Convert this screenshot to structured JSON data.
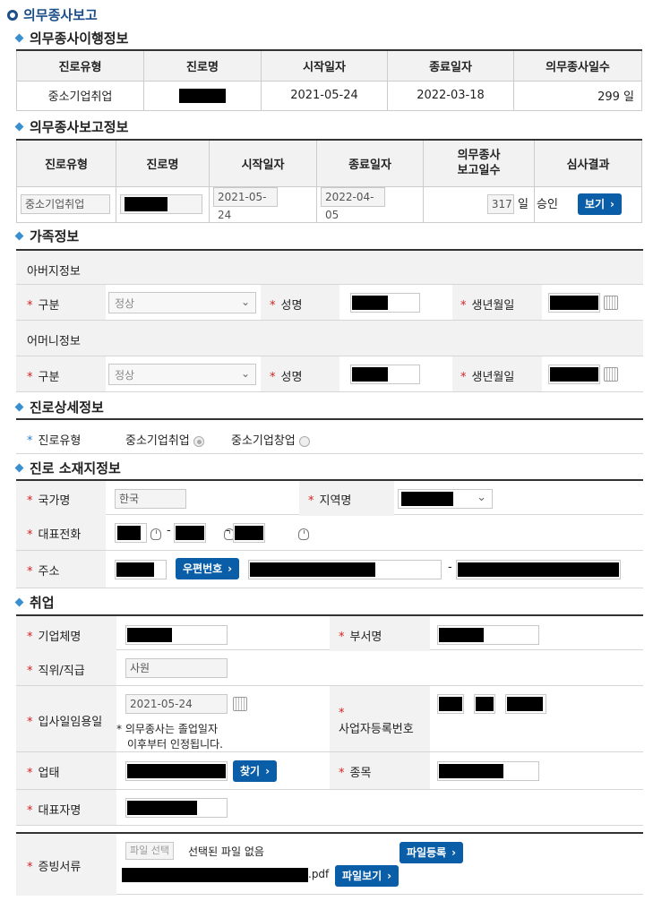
{
  "page": {
    "title": "의무종사보고"
  },
  "sections": {
    "transition": "의무종사이행정보",
    "report": "의무종사보고정보",
    "family": "가족정보",
    "career": "진로상세정보",
    "location": "진로 소재지정보",
    "employment": "취업"
  },
  "transition_table": {
    "headers": [
      "진로유형",
      "진로명",
      "시작일자",
      "종료일자",
      "의무종사일수"
    ],
    "row": {
      "type": "중소기업취업",
      "start": "2021-05-24",
      "end": "2022-03-18",
      "days": "299 일"
    }
  },
  "report_table": {
    "headers": [
      "진로유형",
      "진로명",
      "시작일자",
      "종료일자",
      "의무종사\n보고일수",
      "심사결과"
    ],
    "row": {
      "type": "중소기업취업",
      "start": "2021-05-24",
      "end": "2022-04-05",
      "days": "317",
      "unit": "일",
      "result": "승인",
      "view_label": "보기"
    }
  },
  "family": {
    "father_title": "아버지정보",
    "mother_title": "어머니정보",
    "div_label": "구분",
    "name_label": "성명",
    "birth_label": "생년월일",
    "div_value": "정상"
  },
  "career": {
    "label": "진로유형",
    "opt1": "중소기업취업",
    "opt2": "중소기업창업"
  },
  "location": {
    "country_label": "국가명",
    "country_value": "한국",
    "region_label": "지역명",
    "phone_label": "대표전화",
    "address_label": "주소",
    "zip_button": "우편번호",
    "dash": "-"
  },
  "employment": {
    "company_label": "기업체명",
    "dept_label": "부서명",
    "position_label": "직위/직급",
    "position_value": "사원",
    "date_label": "입사일임용일",
    "date_value": "2021-05-24",
    "note1": "* 의무종사는 졸업일자",
    "note2": "이후부터 인정됩니다.",
    "bizno_label": "사업자등록번호",
    "biztype_label": "업태",
    "find_button": "찾기",
    "item_label": "종목",
    "ceo_label": "대표자명",
    "docs_label": "증빙서류",
    "file_select": "파일 선택",
    "file_none": "선택된 파일 없음",
    "file_register": "파일등록",
    "file_ext": ".pdf",
    "file_view": "파일보기"
  }
}
